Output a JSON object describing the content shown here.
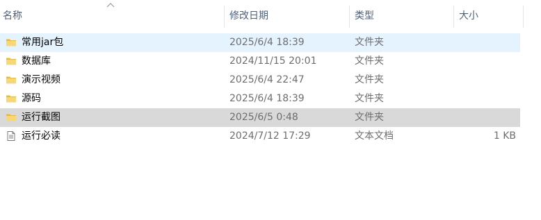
{
  "columns": {
    "name": "名称",
    "date": "修改日期",
    "type": "类型",
    "size": "大小"
  },
  "files": [
    {
      "name": "常用jar包",
      "date": "2025/6/4 18:39",
      "type": "文件夹",
      "size": "",
      "icon": "folder-icon",
      "state": "selected"
    },
    {
      "name": "数据库",
      "date": "2024/11/15 20:01",
      "type": "文件夹",
      "size": "",
      "icon": "folder-icon",
      "state": ""
    },
    {
      "name": "演示视频",
      "date": "2025/6/4 22:47",
      "type": "文件夹",
      "size": "",
      "icon": "folder-icon",
      "state": ""
    },
    {
      "name": "源码",
      "date": "2025/6/4 18:39",
      "type": "文件夹",
      "size": "",
      "icon": "folder-icon",
      "state": ""
    },
    {
      "name": "运行截图",
      "date": "2025/6/5 0:48",
      "type": "文件夹",
      "size": "",
      "icon": "folder-icon",
      "state": "inactive-selected"
    },
    {
      "name": "运行必读",
      "date": "2024/7/12 17:29",
      "type": "文本文档",
      "size": "1 KB",
      "icon": "text-document-icon",
      "state": ""
    }
  ],
  "colors": {
    "selected_bg": "#e5f3ff",
    "inactive_selected_bg": "#d9d9d9",
    "header_text": "#4c607a",
    "folder": "#f8d775"
  }
}
